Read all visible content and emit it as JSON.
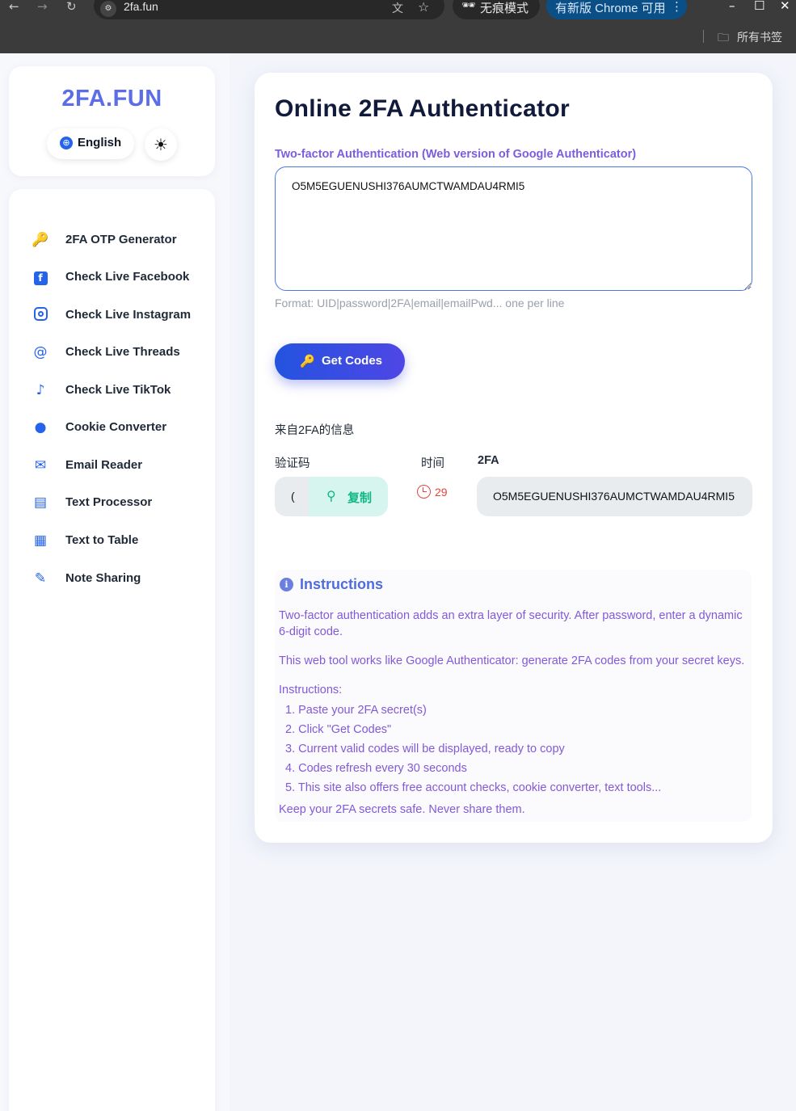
{
  "browser": {
    "url": "2fa.fun",
    "incognito_label": "无痕模式",
    "update_label": "有新版 Chrome 可用",
    "bookmarks_label": "所有书签"
  },
  "sidebar": {
    "logo": "2FA.FUN",
    "language": "English",
    "items": [
      {
        "label": "2FA OTP Generator",
        "icon": "key-icon"
      },
      {
        "label": "Check Live Facebook",
        "icon": "facebook-icon"
      },
      {
        "label": "Check Live Instagram",
        "icon": "instagram-icon"
      },
      {
        "label": "Check Live Threads",
        "icon": "threads-icon"
      },
      {
        "label": "Check Live TikTok",
        "icon": "tiktok-icon"
      },
      {
        "label": "Cookie Converter",
        "icon": "cookie-icon"
      },
      {
        "label": "Email Reader",
        "icon": "envelope-icon"
      },
      {
        "label": "Text Processor",
        "icon": "document-icon"
      },
      {
        "label": "Text to Table",
        "icon": "table-icon"
      },
      {
        "label": "Note Sharing",
        "icon": "pencil-icon"
      }
    ]
  },
  "main": {
    "title": "Online 2FA Authenticator",
    "field_label": "Two-factor Authentication (Web version of Google Authenticator)",
    "secret_value": "O5M5EGUENUSHI376AUMCTWAMDAU4RMI5",
    "hint": "Format: UID|password|2FA|email|emailPwd... one per line",
    "get_codes_label": "Get Codes",
    "info_title": "来自2FA的信息",
    "columns": {
      "code": "验证码",
      "time": "时间",
      "tfa": "2FA"
    },
    "result": {
      "code": "(",
      "copy_label": "复制",
      "seconds": "29",
      "tfa": "O5M5EGUENUSHI376AUMCTWAMDAU4RMI5"
    }
  },
  "instructions": {
    "title": "Instructions",
    "p1": "Two-factor authentication adds an extra layer of security. After password, enter a dynamic 6-digit code.",
    "p2": "This web tool works like Google Authenticator: generate 2FA codes from your secret keys.",
    "steps_heading": "Instructions:",
    "steps": [
      "1. Paste your 2FA secret(s)",
      "2. Click \"Get Codes\"",
      "3. Current valid codes will be displayed, ready to copy",
      "4. Codes refresh every 30 seconds",
      "5. This site also offers free account checks, cookie converter, text tools..."
    ],
    "footer": "Keep your 2FA secrets safe. Never share them."
  },
  "colors": {
    "accent": "#2563eb",
    "logo": "#5b6ee8",
    "instructions_text": "#8259d8",
    "timer": "#e2463b",
    "copy": "#10b981"
  }
}
